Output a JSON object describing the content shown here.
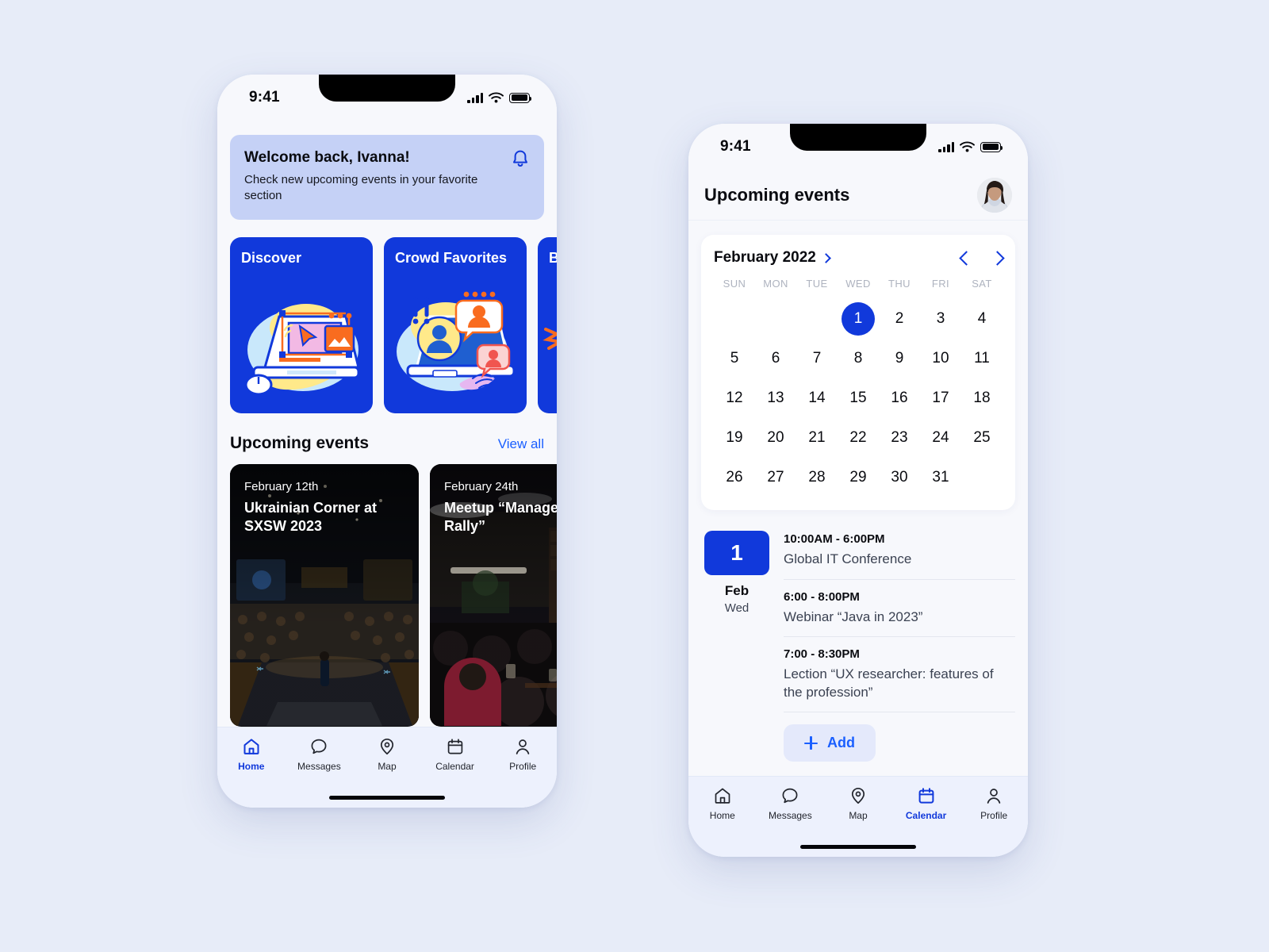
{
  "colors": {
    "page_bg": "#e7ecf8",
    "accent_blue": "#1139db",
    "link_blue": "#1a5fff",
    "banner_bg": "#c5d1f6",
    "screen_bg": "#f7f8fc",
    "tabbar_bg": "#edf1fd"
  },
  "left_phone": {
    "status": {
      "time": "9:41",
      "signal_icon": "signal-bars-icon",
      "wifi_icon": "wifi-icon",
      "battery_icon": "battery-icon"
    },
    "banner": {
      "title": "Welcome back, Ivanna!",
      "subtitle": "Check new upcoming events in your favorite section",
      "bell_icon": "bell-icon"
    },
    "categories": [
      {
        "label": "Discover",
        "art": "laptop-design-illustration"
      },
      {
        "label": "Crowd Favorites",
        "art": "laptop-people-avatars-illustration"
      },
      {
        "label": "B",
        "art": "partial-card-illustration"
      }
    ],
    "section": {
      "title": "Upcoming events",
      "link": "View all"
    },
    "events": [
      {
        "date": "February 12th",
        "name": "Ukrainian Corner at SXSW 2023",
        "photo": "conference-auditorium-stage-photo"
      },
      {
        "date": "February 24th",
        "name": "Meetup “Management Rally”",
        "photo": "indoor-venue-crowd-photo"
      }
    ],
    "tabs": [
      {
        "label": "Home",
        "icon": "home-icon",
        "active": true
      },
      {
        "label": "Messages",
        "icon": "chat-bubble-icon",
        "active": false
      },
      {
        "label": "Map",
        "icon": "map-pin-icon",
        "active": false
      },
      {
        "label": "Calendar",
        "icon": "calendar-icon",
        "active": false
      },
      {
        "label": "Profile",
        "icon": "person-icon",
        "active": false
      }
    ]
  },
  "right_phone": {
    "status": {
      "time": "9:41",
      "signal_icon": "signal-bars-icon",
      "wifi_icon": "wifi-icon",
      "battery_icon": "battery-icon"
    },
    "header": {
      "title": "Upcoming events",
      "avatar": "user-avatar-photo"
    },
    "calendar": {
      "month_label": "February 2022",
      "month_chevron_icon": "chevron-right-icon",
      "prev_icon": "chevron-left-icon",
      "next_icon": "chevron-right-icon",
      "weekdays": [
        "SUN",
        "MON",
        "TUE",
        "WED",
        "THU",
        "FRI",
        "SAT"
      ],
      "lead_blanks": 3,
      "days": [
        1,
        2,
        3,
        4,
        5,
        6,
        7,
        8,
        9,
        10,
        11,
        12,
        13,
        14,
        15,
        16,
        17,
        18,
        19,
        20,
        21,
        22,
        23,
        24,
        25,
        26,
        27,
        28,
        29,
        30,
        31
      ],
      "selected_day": 1
    },
    "schedule": {
      "day_number": "1",
      "month": "Feb",
      "weekday": "Wed",
      "slots": [
        {
          "time": "10:00AM - 6:00PM",
          "name": "Global IT Conference"
        },
        {
          "time": "6:00 - 8:00PM",
          "name": "Webinar “Java in 2023”"
        },
        {
          "time": "7:00 - 8:30PM",
          "name": "Lection “UX researcher: features of the profession”"
        }
      ],
      "add_label": "Add",
      "add_icon": "plus-icon"
    },
    "tabs": [
      {
        "label": "Home",
        "icon": "home-icon",
        "active": false
      },
      {
        "label": "Messages",
        "icon": "chat-bubble-icon",
        "active": false
      },
      {
        "label": "Map",
        "icon": "map-pin-icon",
        "active": false
      },
      {
        "label": "Calendar",
        "icon": "calendar-icon",
        "active": true
      },
      {
        "label": "Profile",
        "icon": "person-icon",
        "active": false
      }
    ]
  }
}
